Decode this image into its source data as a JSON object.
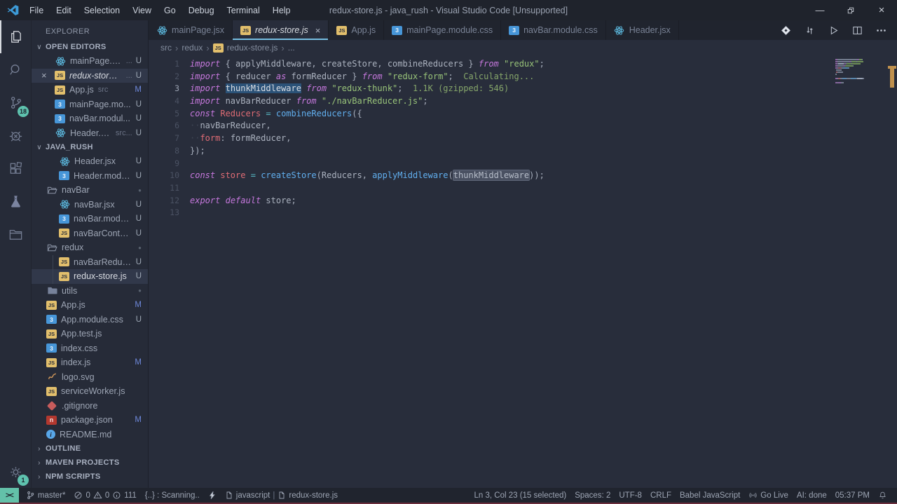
{
  "window": {
    "title": "redux-store.js - java_rush - Visual Studio Code [Unsupported]",
    "controls": {
      "minimize": "—",
      "close": "×"
    }
  },
  "menus": [
    "File",
    "Edit",
    "Selection",
    "View",
    "Go",
    "Debug",
    "Terminal",
    "Help"
  ],
  "activity_bar": {
    "scm_badge": "18",
    "settings_badge": "1"
  },
  "sidebar": {
    "title": "EXPLORER",
    "open_editors_header": "OPEN EDITORS",
    "open_editors": [
      {
        "icon": "react",
        "label": "mainPage.jsx",
        "detail": "...",
        "badge": "U",
        "badge_type": "u"
      },
      {
        "icon": "js",
        "label": "redux-store.js",
        "detail": "...",
        "badge": "U",
        "badge_type": "u",
        "selected": true,
        "italic": true
      },
      {
        "icon": "js",
        "label": "App.js",
        "detail": "src",
        "badge": "M",
        "badge_type": "m"
      },
      {
        "icon": "css",
        "label": "mainPage.mo...",
        "detail": "",
        "badge": "U",
        "badge_type": "u"
      },
      {
        "icon": "css",
        "label": "navBar.modul...",
        "detail": "",
        "badge": "U",
        "badge_type": "u"
      },
      {
        "icon": "react",
        "label": "Header.jsx",
        "detail": "src...",
        "badge": "U",
        "badge_type": "u"
      }
    ],
    "project_header": "JAVA_RUSH",
    "tree": [
      {
        "icon": "react",
        "label": "Header.jsx",
        "badge": "U",
        "badge_type": "u",
        "level": 2
      },
      {
        "icon": "css",
        "label": "Header.modu...",
        "badge": "U",
        "badge_type": "u",
        "level": 2
      },
      {
        "icon": "folder-open",
        "label": "navBar",
        "badge": "●",
        "badge_type": "dot",
        "level": 1
      },
      {
        "icon": "react",
        "label": "navBar.jsx",
        "badge": "U",
        "badge_type": "u",
        "level": 2
      },
      {
        "icon": "css",
        "label": "navBar.modul...",
        "badge": "U",
        "badge_type": "u",
        "level": 2
      },
      {
        "icon": "js",
        "label": "navBarContai...",
        "badge": "U",
        "badge_type": "u",
        "level": 2
      },
      {
        "icon": "folder-open",
        "label": "redux",
        "badge": "●",
        "badge_type": "dot",
        "level": 1
      },
      {
        "icon": "js",
        "label": "navBarReducer...",
        "badge": "U",
        "badge_type": "u",
        "level": 2,
        "guide": true
      },
      {
        "icon": "js",
        "label": "redux-store.js",
        "badge": "U",
        "badge_type": "u",
        "level": 2,
        "guide": true,
        "selected": true
      },
      {
        "icon": "folder",
        "label": "utils",
        "badge": "●",
        "badge_type": "dot",
        "level": 1
      },
      {
        "icon": "js",
        "label": "App.js",
        "badge": "M",
        "badge_type": "m",
        "level": 1
      },
      {
        "icon": "css",
        "label": "App.module.css",
        "badge": "U",
        "badge_type": "u",
        "level": 1
      },
      {
        "icon": "js",
        "label": "App.test.js",
        "badge": "",
        "badge_type": "",
        "level": 1
      },
      {
        "icon": "css",
        "label": "index.css",
        "badge": "",
        "badge_type": "",
        "level": 1
      },
      {
        "icon": "js",
        "label": "index.js",
        "badge": "M",
        "badge_type": "m",
        "level": 1
      },
      {
        "icon": "svgfile",
        "label": "logo.svg",
        "badge": "",
        "badge_type": "",
        "level": 1
      },
      {
        "icon": "js",
        "label": "serviceWorker.js",
        "badge": "",
        "badge_type": "",
        "level": 1
      },
      {
        "icon": "git",
        "label": ".gitignore",
        "badge": "",
        "badge_type": "",
        "level": 1
      },
      {
        "icon": "npm",
        "label": "package.json",
        "badge": "M",
        "badge_type": "m",
        "level": 1
      },
      {
        "icon": "info",
        "label": "README.md",
        "badge": "",
        "badge_type": "",
        "level": 1
      }
    ],
    "sections": [
      "OUTLINE",
      "MAVEN PROJECTS",
      "NPM SCRIPTS"
    ]
  },
  "tabs": [
    {
      "icon": "react",
      "label": "mainPage.jsx"
    },
    {
      "icon": "js",
      "label": "redux-store.js",
      "active": true,
      "italic": true
    },
    {
      "icon": "js",
      "label": "App.js"
    },
    {
      "icon": "css",
      "label": "mainPage.module.css"
    },
    {
      "icon": "css",
      "label": "navBar.module.css"
    },
    {
      "icon": "react",
      "label": "Header.jsx"
    }
  ],
  "breadcrumb": [
    "src",
    "redux",
    "redux-store.js",
    "..."
  ],
  "editor": {
    "lines": [
      {
        "n": 1,
        "tokens": [
          {
            "t": "import",
            "c": "kw"
          },
          {
            "t": " { ",
            "c": "pn"
          },
          {
            "t": "applyMiddleware",
            "c": "vr"
          },
          {
            "t": ", ",
            "c": "pn"
          },
          {
            "t": "createStore",
            "c": "vr"
          },
          {
            "t": ", ",
            "c": "pn"
          },
          {
            "t": "combineReducers",
            "c": "vr"
          },
          {
            "t": " } ",
            "c": "pn"
          },
          {
            "t": "from",
            "c": "kw"
          },
          {
            "t": " ",
            "c": "pn"
          },
          {
            "t": "\"redux\"",
            "c": "st"
          },
          {
            "t": ";",
            "c": "pn"
          }
        ]
      },
      {
        "n": 2,
        "tokens": [
          {
            "t": "import",
            "c": "kw"
          },
          {
            "t": " { ",
            "c": "pn"
          },
          {
            "t": "reducer",
            "c": "vr"
          },
          {
            "t": " ",
            "c": "pn"
          },
          {
            "t": "as",
            "c": "kw"
          },
          {
            "t": " formReducer",
            "c": "vr"
          },
          {
            "t": " } ",
            "c": "pn"
          },
          {
            "t": "from",
            "c": "kw"
          },
          {
            "t": " ",
            "c": "pn"
          },
          {
            "t": "\"redux-form\"",
            "c": "st"
          },
          {
            "t": ";",
            "c": "pn"
          },
          {
            "t": "  Calculating...",
            "c": "an"
          }
        ]
      },
      {
        "n": 3,
        "tokens": [
          {
            "t": "import",
            "c": "kw"
          },
          {
            "t": " ",
            "c": "pn"
          },
          {
            "t": "thunkMiddleware",
            "c": "selhl"
          },
          {
            "t": " ",
            "c": "pn"
          },
          {
            "t": "from",
            "c": "kw"
          },
          {
            "t": " ",
            "c": "pn"
          },
          {
            "t": "\"redux-thunk\"",
            "c": "st"
          },
          {
            "t": ";",
            "c": "pn"
          },
          {
            "t": "  1.1K (gzipped: 546)",
            "c": "an"
          }
        ]
      },
      {
        "n": 4,
        "tokens": [
          {
            "t": "import",
            "c": "kw"
          },
          {
            "t": " navBarReducer ",
            "c": "vr"
          },
          {
            "t": "from",
            "c": "kw"
          },
          {
            "t": " ",
            "c": "pn"
          },
          {
            "t": "\"./navBarReducer.js\"",
            "c": "st"
          },
          {
            "t": ";",
            "c": "pn"
          }
        ]
      },
      {
        "n": 5,
        "tokens": [
          {
            "t": "const",
            "c": "kw"
          },
          {
            "t": " ",
            "c": "pn"
          },
          {
            "t": "Reducers",
            "c": "df"
          },
          {
            "t": " ",
            "c": "pn"
          },
          {
            "t": "=",
            "c": "op"
          },
          {
            "t": " ",
            "c": "pn"
          },
          {
            "t": "combineReducers",
            "c": "fn"
          },
          {
            "t": "({",
            "c": "pn"
          }
        ]
      },
      {
        "n": 6,
        "tokens": [
          {
            "t": "··",
            "c": "ws"
          },
          {
            "t": "navBarReducer",
            "c": "vr"
          },
          {
            "t": ",",
            "c": "pn"
          }
        ]
      },
      {
        "n": 7,
        "tokens": [
          {
            "t": "··",
            "c": "ws"
          },
          {
            "t": "form",
            "c": "df"
          },
          {
            "t": ": ",
            "c": "pn"
          },
          {
            "t": "formReducer",
            "c": "vr"
          },
          {
            "t": ",",
            "c": "pn"
          }
        ]
      },
      {
        "n": 8,
        "tokens": [
          {
            "t": "});",
            "c": "pn"
          }
        ]
      },
      {
        "n": 9,
        "tokens": []
      },
      {
        "n": 10,
        "tokens": [
          {
            "t": "const",
            "c": "kw"
          },
          {
            "t": " ",
            "c": "pn"
          },
          {
            "t": "store",
            "c": "df"
          },
          {
            "t": " ",
            "c": "pn"
          },
          {
            "t": "=",
            "c": "op"
          },
          {
            "t": " ",
            "c": "pn"
          },
          {
            "t": "createStore",
            "c": "fn"
          },
          {
            "t": "(",
            "c": "pn"
          },
          {
            "t": "Reducers",
            "c": "vr"
          },
          {
            "t": ", ",
            "c": "pn"
          },
          {
            "t": "applyMiddleware",
            "c": "fn"
          },
          {
            "t": "(",
            "c": "pn"
          },
          {
            "t": "thunkMiddleware",
            "c": "wordhl"
          },
          {
            "t": "));",
            "c": "pn"
          }
        ]
      },
      {
        "n": 11,
        "tokens": []
      },
      {
        "n": 12,
        "tokens": [
          {
            "t": "export",
            "c": "kw"
          },
          {
            "t": " ",
            "c": "pn"
          },
          {
            "t": "default",
            "c": "kw"
          },
          {
            "t": " store",
            "c": "vr"
          },
          {
            "t": ";",
            "c": "pn"
          }
        ]
      },
      {
        "n": 13,
        "tokens": []
      }
    ]
  },
  "status_bar": {
    "remote": "><",
    "branch": "master*",
    "errors": "0",
    "warnings": "0",
    "infos": "111",
    "scanning": "{..} : Scanning..",
    "lang_left": "javascript",
    "separator": "|",
    "file_left": "redux-store.js",
    "cursor": "Ln 3, Col 23 (15 selected)",
    "spaces": "Spaces: 2",
    "encoding": "UTF-8",
    "eol": "CRLF",
    "language": "Babel JavaScript",
    "go_live": "Go Live",
    "ai": "AI: done",
    "time": "05:37 PM"
  },
  "colors": {
    "accent_teal": "#63c1a9",
    "selection_blue": "#2b5278",
    "keyword": "#c678dd",
    "string": "#98c379",
    "function": "#61afef",
    "definition": "#e06c75",
    "annotation": "#85a56a",
    "tab_underline": "#75bde0",
    "ruler_mark": "#c0914e"
  }
}
